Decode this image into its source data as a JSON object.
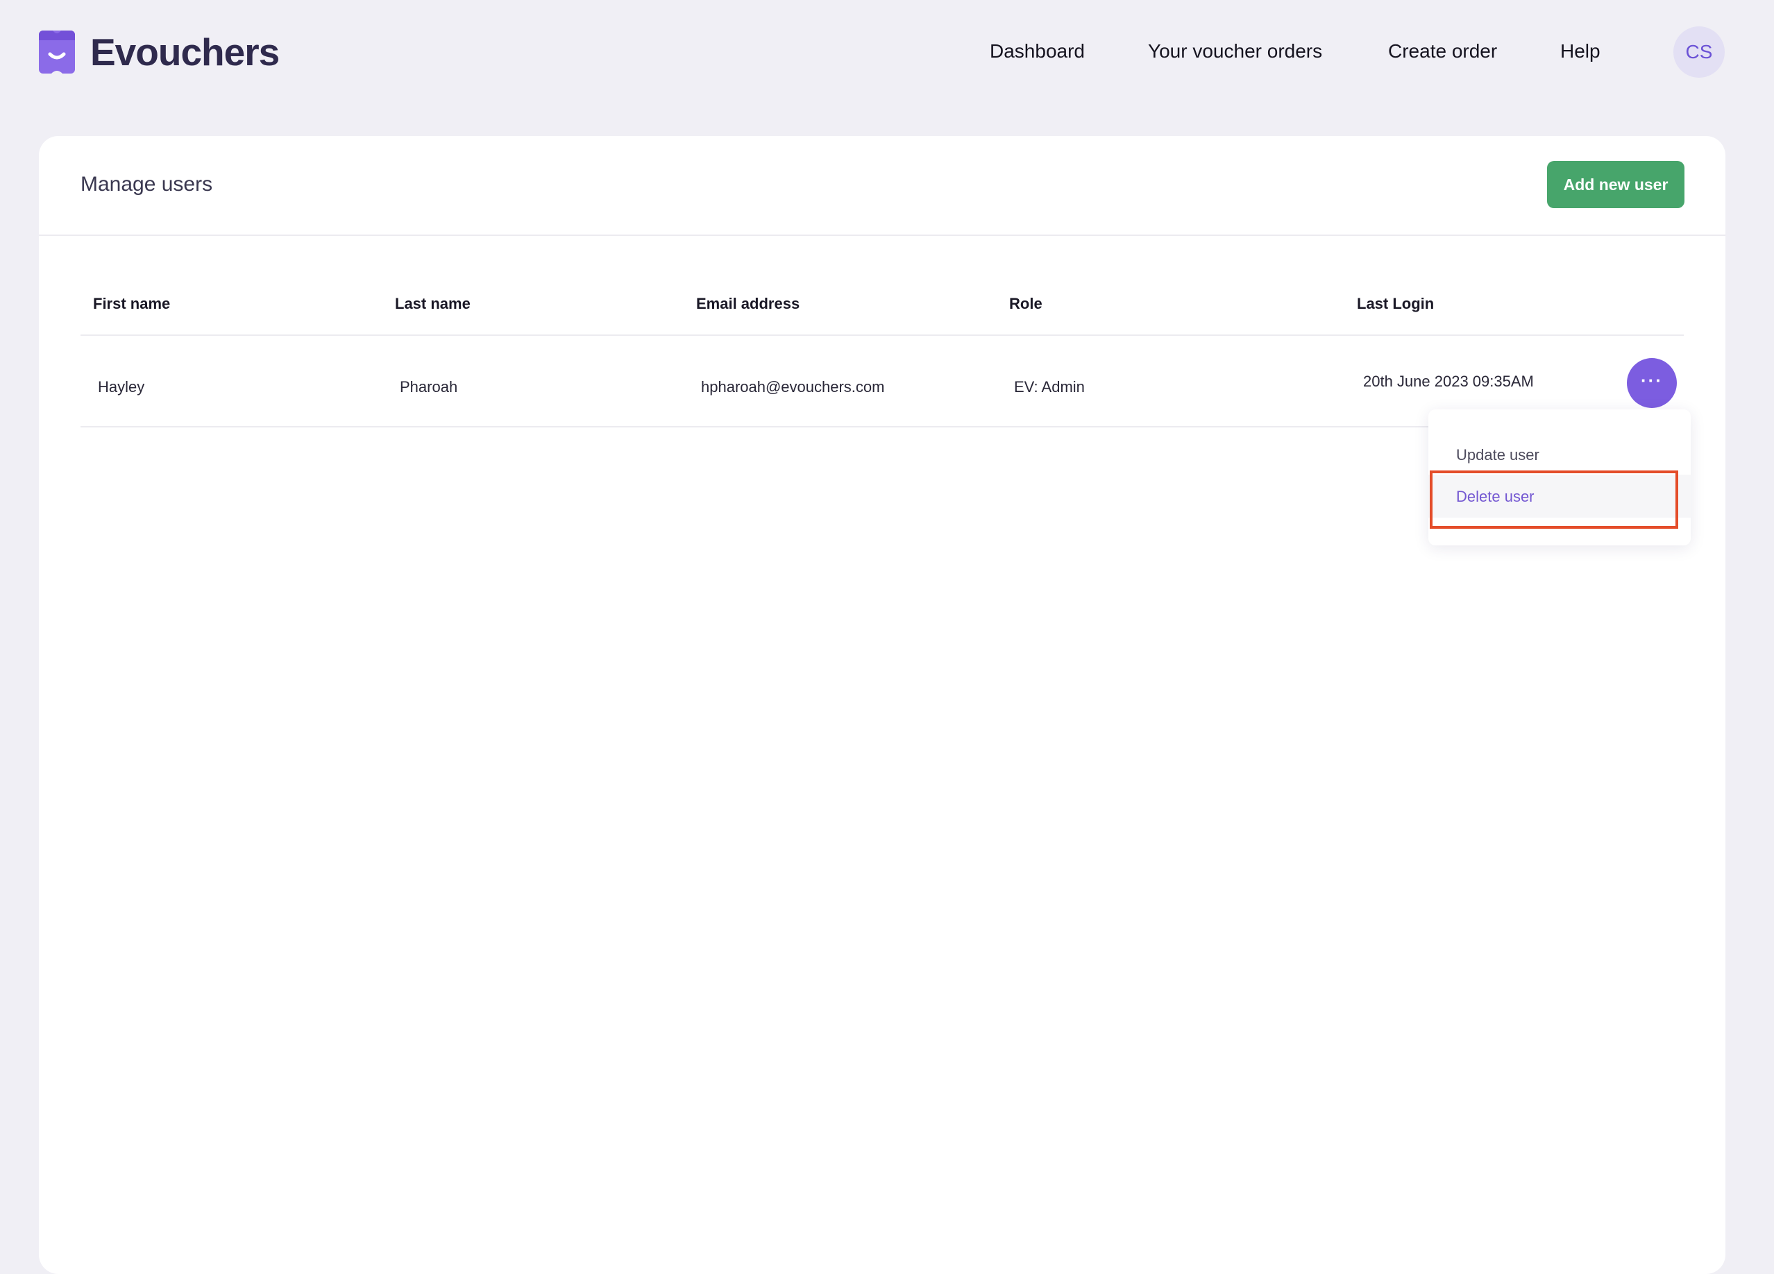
{
  "app": {
    "name": "Evouchers"
  },
  "nav": {
    "items": [
      "Dashboard",
      "Your voucher orders",
      "Create order",
      "Help"
    ],
    "avatar_initials": "CS"
  },
  "card": {
    "title": "Manage users",
    "add_button": "Add new user"
  },
  "table": {
    "headers": [
      "First name",
      "Last name",
      "Email address",
      "Role",
      "Last Login"
    ],
    "rows": [
      {
        "first_name": "Hayley",
        "last_name": "Pharoah",
        "email": "hpharoah@evouchers.com",
        "role": "EV: Admin",
        "last_login": "20th June 2023 09:35AM"
      }
    ]
  },
  "row_menu": {
    "icon": "ellipsis-icon",
    "items": [
      "Update user",
      "Delete user"
    ]
  },
  "colors": {
    "brand": "#7c5de0",
    "primary_button": "#47a56b",
    "highlight": "#e44d2a",
    "background": "#f0eff5"
  }
}
